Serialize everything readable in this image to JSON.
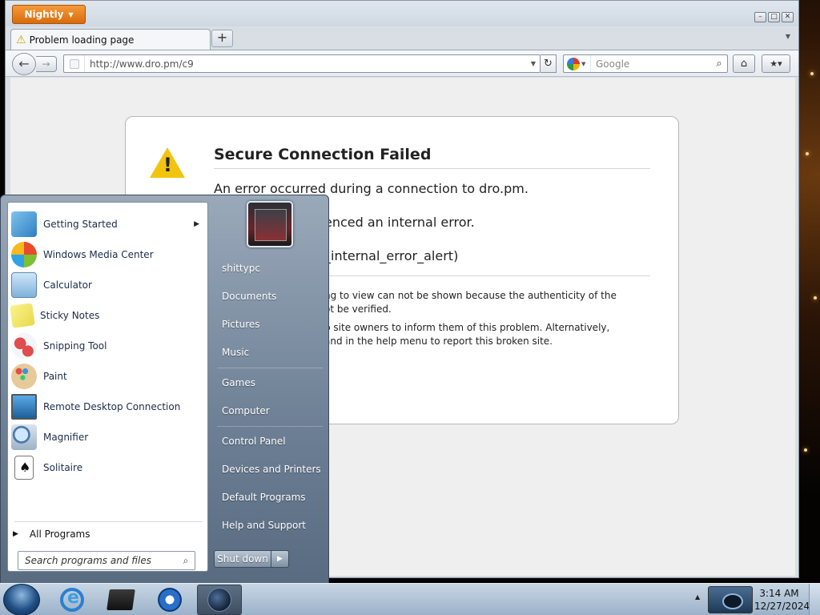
{
  "browser": {
    "app_menu_label": "Nightly",
    "tab": {
      "title": "Problem loading page"
    },
    "new_tab_label": "+",
    "url": "http://www.dro.pm/c9",
    "search_engine_icon": "google-icon",
    "search_placeholder": "Google"
  },
  "error_page": {
    "title": "Secure Connection Failed",
    "lines": [
      "An error occurred during a connection to dro.pm.",
      "enced an internal error.",
      "_internal_error_alert)"
    ],
    "details": [
      "ng to view can not be shown because the authenticity of the",
      "ot be verified.",
      "b site owners to inform them of this problem. Alternatively,",
      "and in the help menu to report this broken site."
    ]
  },
  "start_menu": {
    "programs": [
      {
        "label": "Getting Started",
        "icon": "getting-started-icon",
        "has_submenu": true
      },
      {
        "label": "Windows Media Center",
        "icon": "media-center-icon"
      },
      {
        "label": "Calculator",
        "icon": "calculator-icon"
      },
      {
        "label": "Sticky Notes",
        "icon": "sticky-notes-icon"
      },
      {
        "label": "Snipping Tool",
        "icon": "snipping-tool-icon"
      },
      {
        "label": "Paint",
        "icon": "paint-icon"
      },
      {
        "label": "Remote Desktop Connection",
        "icon": "remote-desktop-icon"
      },
      {
        "label": "Magnifier",
        "icon": "magnifier-icon"
      },
      {
        "label": "Solitaire",
        "icon": "solitaire-icon"
      }
    ],
    "all_programs": "All Programs",
    "search_placeholder": "Search programs and files",
    "user_name": "shittypc",
    "right_items": [
      "Documents",
      "Pictures",
      "Music",
      "Games",
      "Computer",
      "Control Panel",
      "Devices and Printers",
      "Default Programs",
      "Help and Support"
    ],
    "shutdown_label": "Shut down"
  },
  "taskbar": {
    "time": "3:14 AM",
    "date": "12/27/2024",
    "pinned": [
      "internet-explorer-icon",
      "folder-icon",
      "media-player-icon",
      "firefox-nightly-icon"
    ]
  },
  "colors": {
    "app_menu": "#e07b1a",
    "start_menu_link": "#1b2b48",
    "warning": "#f1c40f"
  }
}
